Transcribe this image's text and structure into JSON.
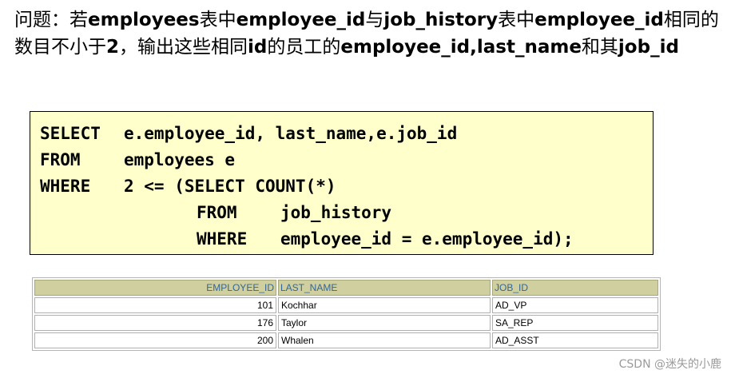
{
  "question": {
    "segments": [
      {
        "text": "问题：若",
        "bold": false
      },
      {
        "text": "employees",
        "bold": true
      },
      {
        "text": "表中",
        "bold": false
      },
      {
        "text": "employee_id",
        "bold": true
      },
      {
        "text": "与",
        "bold": false
      },
      {
        "text": "job_history",
        "bold": true
      },
      {
        "text": "表中",
        "bold": false
      },
      {
        "text": "employee_id",
        "bold": true
      },
      {
        "text": "相同的数目不小于",
        "bold": false
      },
      {
        "text": "2",
        "bold": true
      },
      {
        "text": "，输出这些相同",
        "bold": false
      },
      {
        "text": "id",
        "bold": true
      },
      {
        "text": "的员工的",
        "bold": false
      },
      {
        "text": "employee_id,last_name",
        "bold": true
      },
      {
        "text": "和其",
        "bold": false
      },
      {
        "text": "job_id",
        "bold": true
      }
    ]
  },
  "sql": {
    "line1_kw": "SELECT",
    "line1_rest": "e.employee_id, last_name,e.job_id",
    "line2_kw": "FROM",
    "line2_rest": "employees e",
    "line3_kw": "WHERE",
    "line3_rest": "2 <= (SELECT COUNT(*)",
    "line4_kw": "FROM",
    "line4_rest": "job_history",
    "line5_kw": "WHERE",
    "line5_rest": "employee_id = e.employee_id);"
  },
  "result": {
    "headers": [
      "EMPLOYEE_ID",
      "LAST_NAME",
      "JOB_ID"
    ],
    "rows": [
      [
        "101",
        "Kochhar",
        "AD_VP"
      ],
      [
        "176",
        "Taylor",
        "SA_REP"
      ],
      [
        "200",
        "Whalen",
        "AD_ASST"
      ]
    ]
  },
  "watermark": "CSDN @迷失的小鹿",
  "colors": {
    "sql_background": "#ffffcc",
    "header_background": "#cfcf9f",
    "header_text": "#336699"
  }
}
